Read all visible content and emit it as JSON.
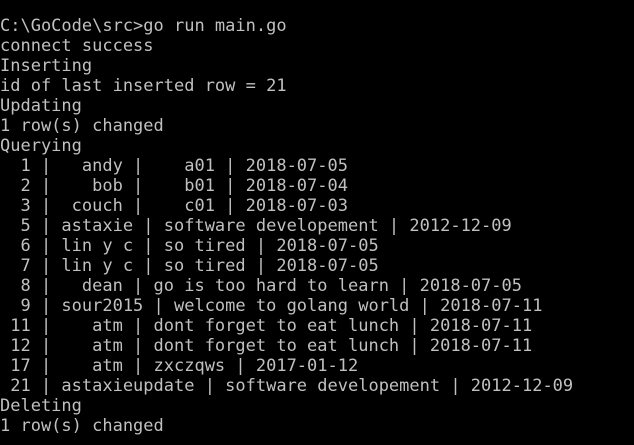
{
  "console": {
    "background": "#000000",
    "foreground": "#c0c0c0",
    "lines": [
      "C:\\GoCode\\src>go run main.go",
      "connect success",
      "Inserting",
      "id of last inserted row = 21",
      "Updating",
      "1 row(s) changed",
      "Querying",
      "  1 |   andy |    a01 | 2018-07-05",
      "  2 |    bob |    b01 | 2018-07-04",
      "  3 |  couch |    c01 | 2018-07-03",
      "  5 | astaxie | software developement | 2012-12-09",
      "  6 | lin y c | so tired | 2018-07-05",
      "  7 | lin y c | so tired | 2018-07-05",
      "  8 |   dean | go is too hard to learn | 2018-07-05",
      "  9 | sour2015 | welcome to golang world | 2018-07-11",
      " 11 |    atm | dont forget to eat lunch | 2018-07-11",
      " 12 |    atm | dont forget to eat lunch | 2018-07-11",
      " 17 |    atm | zxczqws | 2017-01-12",
      " 21 | astaxieupdate | software developement | 2012-12-09",
      "Deleting",
      "1 row(s) changed"
    ]
  }
}
